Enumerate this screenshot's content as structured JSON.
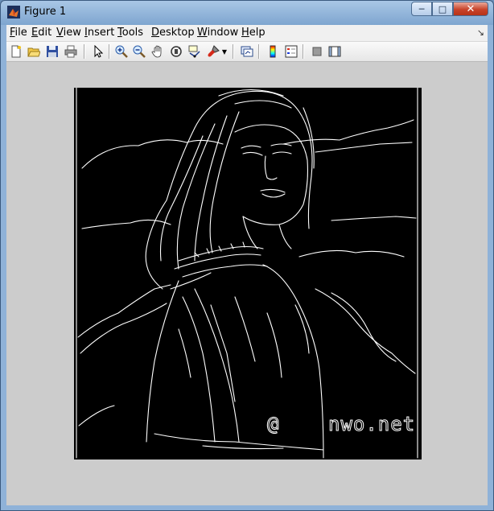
{
  "window": {
    "title": "Figure 1"
  },
  "menu": [
    {
      "label": "File",
      "key": "F",
      "rest": "ile"
    },
    {
      "label": "Edit",
      "key": "E",
      "rest": "dit"
    },
    {
      "label": "View",
      "key": "V",
      "rest": "iew"
    },
    {
      "label": "Insert",
      "key": "I",
      "rest": "nsert"
    },
    {
      "label": "Tools",
      "key": "T",
      "rest": "ools"
    },
    {
      "label": "Desktop",
      "key": "D",
      "rest": "esktop"
    },
    {
      "label": "Window",
      "key": "W",
      "rest": "indow"
    },
    {
      "label": "Help",
      "key": "H",
      "rest": "elp"
    }
  ],
  "toolbar": [
    "new-figure-icon",
    "open-file-icon",
    "save-icon",
    "print-icon",
    "edit-plot-icon",
    "zoom-in-icon",
    "zoom-out-icon",
    "pan-icon",
    "rotate-3d-icon",
    "data-cursor-icon",
    "brush-icon",
    "link-plot-icon",
    "colorbar-icon",
    "legend-icon",
    "hide-plot-tools-icon",
    "show-plot-tools-icon"
  ],
  "figure": {
    "watermark_left": "@",
    "watermark_right": "nwo.net"
  },
  "colors": {
    "edge": "#ffffff",
    "background": "#000000",
    "figure_bg": "#cccccc"
  }
}
